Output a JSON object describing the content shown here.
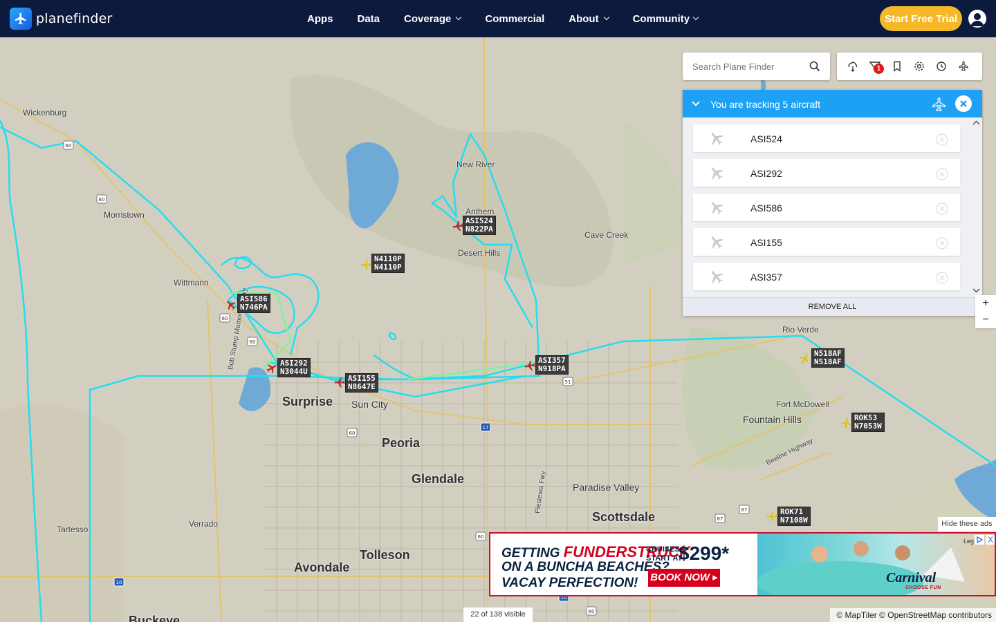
{
  "brand": {
    "name": "planefinder"
  },
  "nav": {
    "items": [
      {
        "label": "Apps",
        "dropdown": false
      },
      {
        "label": "Data",
        "dropdown": false
      },
      {
        "label": "Coverage",
        "dropdown": true
      },
      {
        "label": "Commercial",
        "dropdown": false
      },
      {
        "label": "About",
        "dropdown": true
      },
      {
        "label": "Community",
        "dropdown": true
      }
    ],
    "cta": "Start Free Trial"
  },
  "search": {
    "placeholder": "Search Plane Finder"
  },
  "toolbar": {
    "icons": [
      "weather-icon",
      "filter-icon",
      "bookmark-icon",
      "settings-icon",
      "history-icon",
      "playback-icon"
    ],
    "filter_badge": "1"
  },
  "tracking": {
    "title": "You are tracking 5 aircraft",
    "aircraft": [
      "ASI524",
      "ASI292",
      "ASI586",
      "ASI155",
      "ASI357"
    ],
    "remove_all": "REMOVE ALL"
  },
  "map": {
    "places": [
      {
        "name": "Wickenburg",
        "size": "normal"
      },
      {
        "name": "Morristown",
        "size": "normal"
      },
      {
        "name": "Wittmann",
        "size": "normal"
      },
      {
        "name": "New River",
        "size": "normal"
      },
      {
        "name": "Anthem",
        "size": "normal"
      },
      {
        "name": "Desert Hills",
        "size": "normal"
      },
      {
        "name": "Cave Creek",
        "size": "normal"
      },
      {
        "name": "Rio Verde",
        "size": "normal"
      },
      {
        "name": "Fort McDowell",
        "size": "normal"
      },
      {
        "name": "Fountain Hills",
        "size": "med"
      },
      {
        "name": "Surprise",
        "size": "big"
      },
      {
        "name": "Sun City",
        "size": "med"
      },
      {
        "name": "Peoria",
        "size": "big"
      },
      {
        "name": "Glendale",
        "size": "big"
      },
      {
        "name": "Paradise Valley",
        "size": "med"
      },
      {
        "name": "Scottsdale",
        "size": "big"
      },
      {
        "name": "Tolleson",
        "size": "big"
      },
      {
        "name": "Avondale",
        "size": "big"
      },
      {
        "name": "Verrado",
        "size": "normal"
      },
      {
        "name": "Tartesso",
        "size": "normal"
      },
      {
        "name": "Buckeye",
        "size": "big"
      },
      {
        "name": "Bob Stump Memorial Pkwy",
        "size": "normal"
      },
      {
        "name": "Beeline Highway",
        "size": "normal"
      },
      {
        "name": "Piestewa Fwy",
        "size": "normal"
      }
    ],
    "road_shields": [
      "60",
      "60",
      "60",
      "60",
      "60",
      "60",
      "60",
      "51",
      "17",
      "87",
      "87",
      "10",
      "10"
    ],
    "flights": [
      {
        "callsign": "ASI524",
        "reg": "N822PA",
        "tracked": true
      },
      {
        "callsign": "N4110P",
        "reg": "N4110P",
        "tracked": false
      },
      {
        "callsign": "ASI586",
        "reg": "N746PA",
        "tracked": true
      },
      {
        "callsign": "ASI292",
        "reg": "N3044U",
        "tracked": true
      },
      {
        "callsign": "ASI155",
        "reg": "N8647E",
        "tracked": true
      },
      {
        "callsign": "ASI357",
        "reg": "N918PA",
        "tracked": true
      },
      {
        "callsign": "N518AF",
        "reg": "N518AF",
        "tracked": false
      },
      {
        "callsign": "ROK53",
        "reg": "N7053W",
        "tracked": false
      },
      {
        "callsign": "ROK71",
        "reg": "N7108W",
        "tracked": false
      }
    ],
    "zoom_in": "+",
    "zoom_out": "−",
    "visible_count": "22 of 138 visible",
    "attribution": "© MapTiler © OpenStreetMap contributors"
  },
  "ad": {
    "hide_label": "Hide these ads",
    "headline_pre": "GETTING",
    "headline_brand": "FUNDERSTRUCK",
    "line2": "ON A BUNCHA BEACHES?",
    "line3": "VACAY PERFECTION!",
    "cruises_label": "CRUISES",
    "start_at": "START AT",
    "price": "$299*",
    "cta": "BOOK NOW",
    "brand": "Carnival",
    "brand_tagline": "CHOOSE FUN",
    "legal": "Leg",
    "close": "X"
  },
  "colors": {
    "nav_bg": "#0c1a3d",
    "cta_bg": "#f5b826",
    "panel_header": "#1da1f5",
    "track_line": "#25dcf0",
    "track_fresh": "#7ff0a0",
    "plane_tracked": "#c0272d",
    "plane_other": "#e0c21a"
  }
}
